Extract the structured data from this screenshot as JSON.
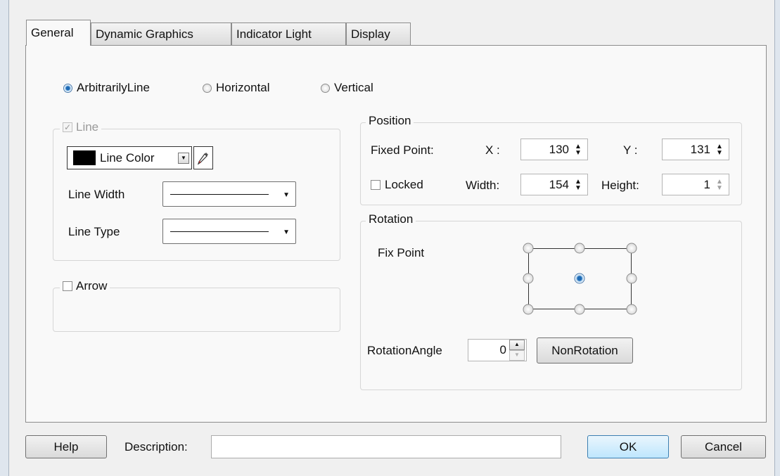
{
  "tabs": [
    "General",
    "Dynamic Graphics",
    "Indicator Light",
    "Display"
  ],
  "line_mode": {
    "options": [
      "ArbitrarilyLine",
      "Horizontal",
      "Vertical"
    ],
    "selected": "ArbitrarilyLine"
  },
  "line_group": {
    "title": "Line",
    "checked": true,
    "enabled": false,
    "color_label": "Line Color",
    "color_value": "#000000",
    "width_label": "Line Width",
    "type_label": "Line Type"
  },
  "arrow_group": {
    "title": "Arrow",
    "checked": false
  },
  "position": {
    "title": "Position",
    "fixed_point_label": "Fixed Point:",
    "x_label": "X :",
    "x_value": "130",
    "y_label": "Y :",
    "y_value": "131",
    "locked_label": "Locked",
    "locked": false,
    "width_label": "Width:",
    "width_value": "154",
    "height_label": "Height:",
    "height_value": "1"
  },
  "rotation": {
    "title": "Rotation",
    "fix_point_label": "Fix Point",
    "selected_anchor": "center",
    "angle_label": "RotationAngle",
    "angle_value": "0",
    "nonrotation_label": "NonRotation"
  },
  "footer": {
    "help_label": "Help",
    "description_label": "Description:",
    "description_value": "",
    "ok_label": "OK",
    "cancel_label": "Cancel"
  },
  "colors": {
    "accent": "#1d6ab5",
    "panel_bg": "#f9f9f9",
    "window_bg": "#f0f0f0"
  }
}
